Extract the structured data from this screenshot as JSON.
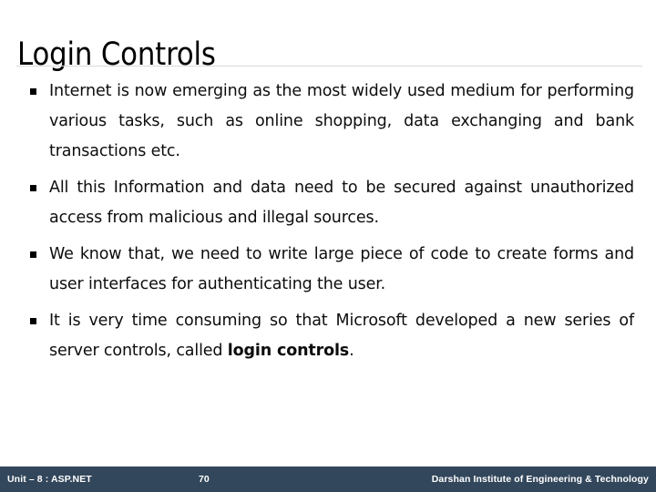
{
  "slide": {
    "title": "Login Controls",
    "bullet_marker": "black-square-bullet",
    "bullets": [
      {
        "text_before": "Internet is now emerging as the most widely used medium for performing various tasks, such as online shopping, data exchanging and bank transactions etc.",
        "bold": "",
        "text_after": ""
      },
      {
        "text_before": "All this Information and data need to be secured against unauthorized access from malicious and illegal sources.",
        "bold": "",
        "text_after": ""
      },
      {
        "text_before": "We know that, we need to write large piece of code to create forms and user interfaces for authenticating the user.",
        "bold": "",
        "text_after": ""
      },
      {
        "text_before": "It is very time consuming so that Microsoft developed a new series of server controls, called ",
        "bold": "login controls",
        "text_after": "."
      }
    ]
  },
  "footer": {
    "unit_label": "Unit – 8 : ASP.NET",
    "page_number": "70",
    "institute": "Darshan Institute of Engineering & Technology",
    "background_color": "#33475c",
    "text_color": "#ffffff"
  }
}
